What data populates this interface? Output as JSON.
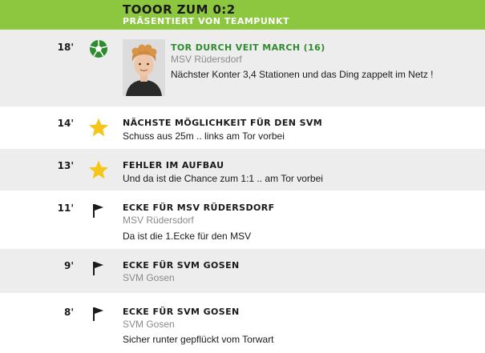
{
  "header": {
    "title": "TOOOR ZUM 0:2",
    "subtitle": "PRÄSENTIERT VON TEAMPUNKT"
  },
  "events": [
    {
      "minute": "18'",
      "icon": "soccer-ball-icon",
      "title": "TOR DURCH VEIT MARCH (16)",
      "team": "MSV Rüdersdorf",
      "text": "Nächster Konter 3,4 Stationen und das Ding zappelt im Netz !",
      "has_photo": true
    },
    {
      "minute": "14'",
      "icon": "star-icon",
      "title": "NÄCHSTE MÖGLICHKEIT FÜR DEN SVM",
      "team": "",
      "text": "Schuss aus 25m .. links am Tor vorbei"
    },
    {
      "minute": "13'",
      "icon": "star-icon",
      "title": "FEHLER IM AUFBAU",
      "team": "",
      "text": "Und da ist die Chance zum 1:1 .. am Tor vorbei"
    },
    {
      "minute": "11'",
      "icon": "corner-flag-icon",
      "title": "ECKE FÜR MSV RÜDERSDORF",
      "team": "MSV Rüdersdorf",
      "text": "Da ist die 1.Ecke für den MSV"
    },
    {
      "minute": "9'",
      "icon": "corner-flag-icon",
      "title": "ECKE FÜR SVM GOSEN",
      "team": "SVM Gosen",
      "text": ""
    },
    {
      "minute": "8'",
      "icon": "corner-flag-icon",
      "title": "ECKE FÜR SVM GOSEN",
      "team": "SVM Gosen",
      "text": "Sicher runter gepflückt vom Torwart"
    }
  ],
  "colors": {
    "banner": "#8dc63f",
    "goal_title": "#2e8b2e",
    "star": "#f5c518",
    "row_alt": "#ededed"
  }
}
